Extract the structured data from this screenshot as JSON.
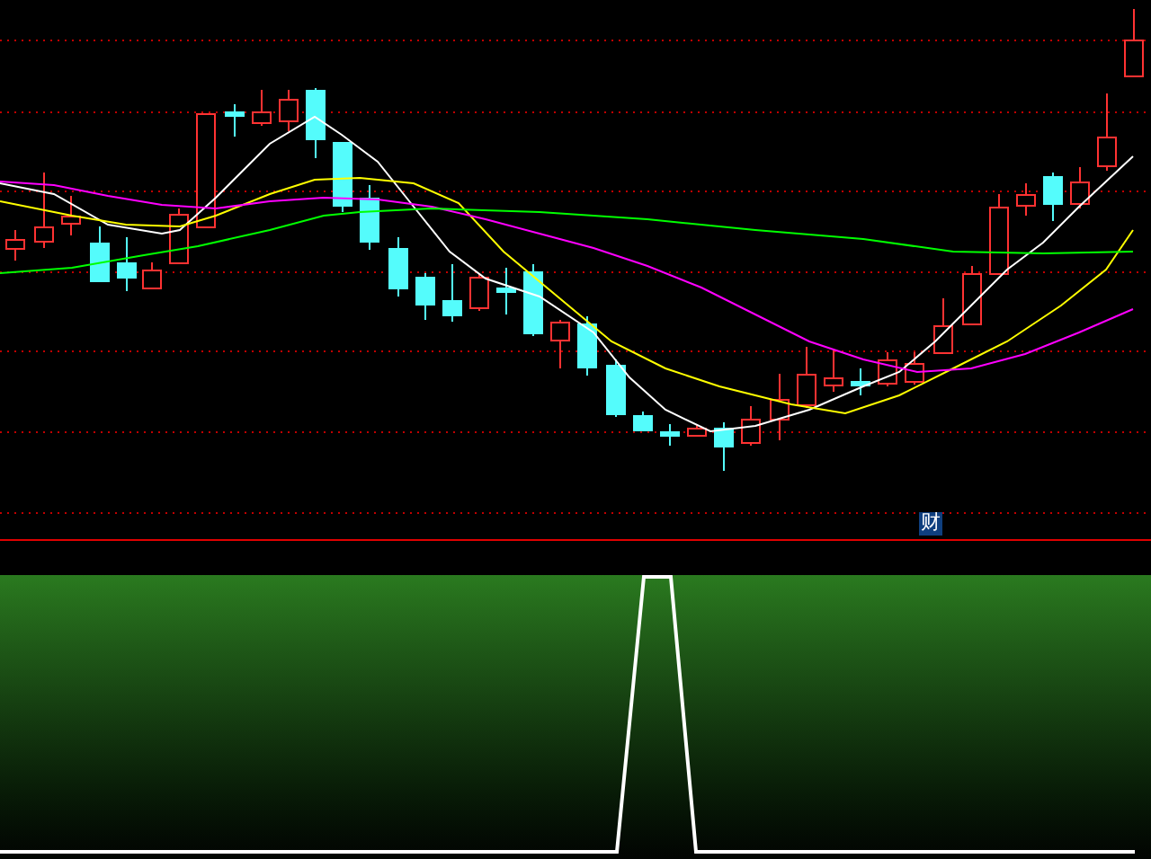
{
  "chart_badge": {
    "label": "财"
  }
}
